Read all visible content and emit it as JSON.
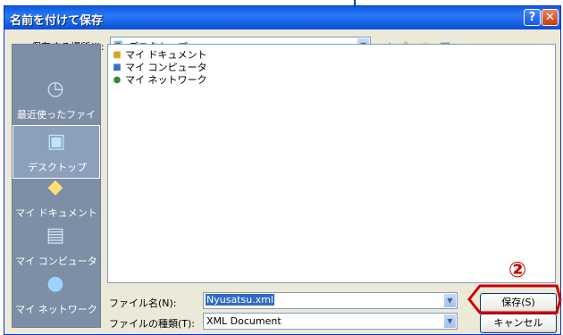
{
  "dialog": {
    "title": "名前を付けて保存",
    "help_label": "?",
    "close_label": "✕"
  },
  "location": {
    "label": "保存する場所(I):",
    "value": "デスクトップ"
  },
  "places": [
    {
      "label": "最近使ったファイル",
      "icon": "recent-icon",
      "selected": false
    },
    {
      "label": "デスクトップ",
      "icon": "desktop-icon",
      "selected": true
    },
    {
      "label": "マイ ドキュメント",
      "icon": "my-documents-icon",
      "selected": false
    },
    {
      "label": "マイ コンピュータ",
      "icon": "my-computer-icon",
      "selected": false
    },
    {
      "label": "マイ ネットワーク",
      "icon": "my-network-icon",
      "selected": false
    }
  ],
  "files": [
    {
      "name": "マイ ドキュメント",
      "icon": "folder-icon"
    },
    {
      "name": "マイ コンピュータ",
      "icon": "computer-icon"
    },
    {
      "name": "マイ ネットワーク",
      "icon": "network-icon"
    }
  ],
  "filename": {
    "label": "ファイル名(N):",
    "value": "Nyusatsu.xml"
  },
  "filetype": {
    "label": "ファイルの種類(T):",
    "value": "XML Document"
  },
  "buttons": {
    "save": "保存(S)",
    "cancel": "キャンセル"
  },
  "annotation": {
    "marker": "②",
    "color": "#cc0000"
  }
}
